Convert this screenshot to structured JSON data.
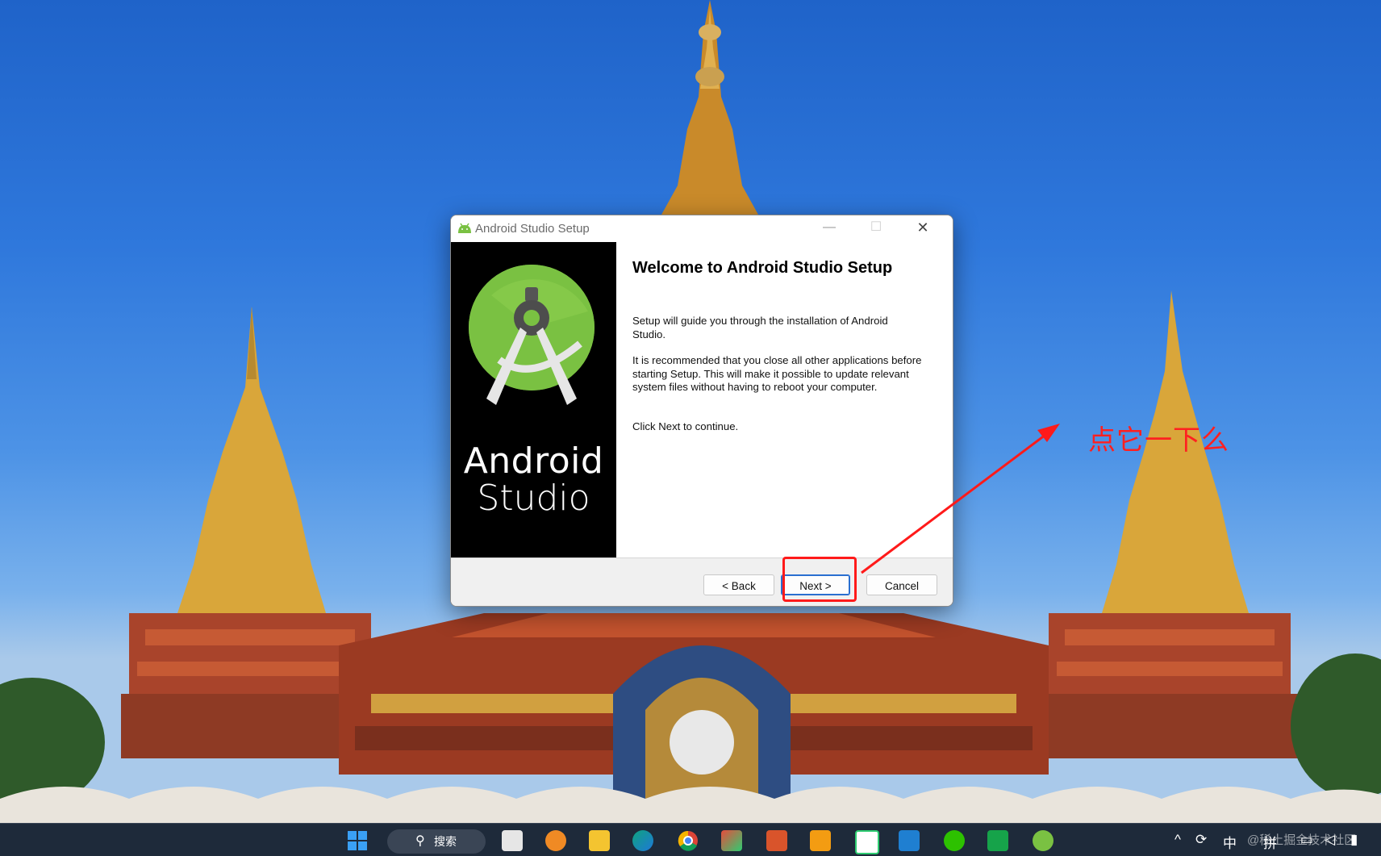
{
  "dialog": {
    "title": "Android Studio Setup",
    "window_controls": {
      "minimize": "—",
      "maximize": "☐",
      "close": "✕"
    },
    "banner": {
      "line1": "Android",
      "line2": "Studio"
    },
    "heading": "Welcome to Android Studio Setup",
    "paragraphs": {
      "p1": "Setup will guide you through the installation of Android Studio.",
      "p2": "It is recommended that you close all other applications before starting Setup. This will make it possible to update relevant system files without having to reboot your computer.",
      "p3": "Click Next to continue."
    },
    "buttons": {
      "back": "< Back",
      "next": "Next >",
      "cancel": "Cancel"
    }
  },
  "annotation": {
    "text": "点它一下么",
    "color": "#ff2020"
  },
  "taskbar": {
    "search_label": "搜索",
    "tray": {
      "ime_cn": "中",
      "ime_pinyin": "拼"
    }
  },
  "watermark": "@稀土掘金技术社区",
  "colors": {
    "android_green": "#7ac142",
    "taskbar": "#1e2a3a",
    "highlight": "#ff1a1a"
  }
}
